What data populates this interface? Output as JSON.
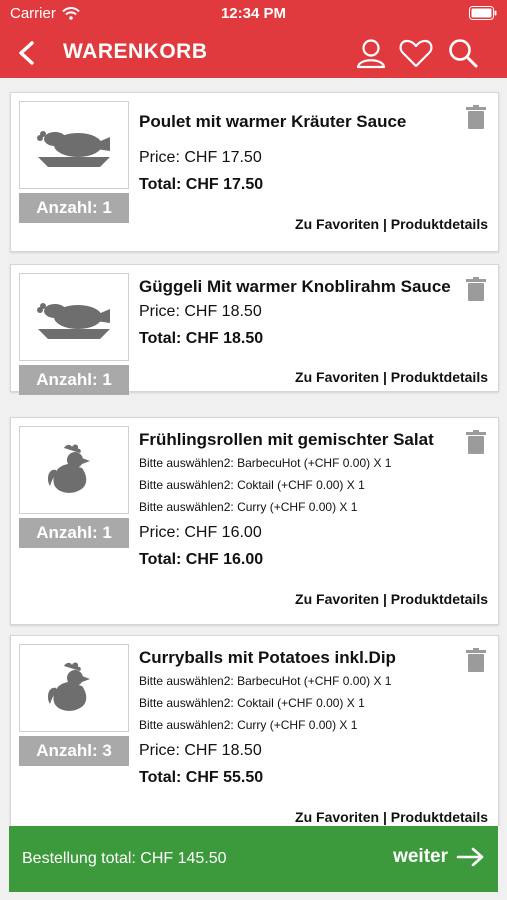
{
  "status": {
    "carrier": "Carrier",
    "time": "12:34 PM"
  },
  "header": {
    "title": "WARENKORB"
  },
  "items": [
    {
      "name": "Poulet mit warmer Kräuter Sauce",
      "image": "chicken-icon",
      "quantity": "Anzahl: 1",
      "options": [],
      "price": "Price: CHF 17.50",
      "total": "Total: CHF 17.50",
      "favorites": "Zu Favoriten",
      "separator": "|",
      "details": "Produktdetails"
    },
    {
      "name": "Güggeli Mit warmer Knoblirahm Sauce",
      "image": "chicken-icon",
      "quantity": "Anzahl: 1",
      "options": [],
      "price": "Price: CHF 18.50",
      "total": "Total: CHF 18.50",
      "favorites": "Zu Favoriten",
      "separator": "|",
      "details": "Produktdetails"
    },
    {
      "name": "Frühlingsrollen mit gemischter Salat",
      "image": "rooster-icon",
      "quantity": "Anzahl: 1",
      "options": [
        "Bitte auswählen2: BarbecuHot (+CHF 0.00) X 1",
        "Bitte auswählen2: Coktail (+CHF 0.00) X 1",
        "Bitte auswählen2: Curry (+CHF 0.00) X 1"
      ],
      "price": "Price: CHF 16.00",
      "total": "Total: CHF 16.00",
      "favorites": "Zu Favoriten",
      "separator": "|",
      "details": "Produktdetails"
    },
    {
      "name": "Curryballs mit Potatoes inkl.Dip",
      "image": "rooster-icon",
      "quantity": "Anzahl: 3",
      "options": [
        "Bitte auswählen2: BarbecuHot (+CHF 0.00) X 1",
        "Bitte auswählen2: Coktail (+CHF 0.00) X 1",
        "Bitte auswählen2: Curry (+CHF 0.00) X 1"
      ],
      "price": "Price: CHF 18.50",
      "total": "Total: CHF 55.50",
      "favorites": "Zu Favoriten",
      "separator": "|",
      "details": "Produktdetails"
    }
  ],
  "footer": {
    "order_total": "Bestellung total: CHF 145.50",
    "next_label": "weiter"
  },
  "colors": {
    "header": "#e0393e",
    "footer": "#3c9a3c",
    "quantity_badge": "#a9a9a9",
    "icon": "#6e6e6e"
  }
}
